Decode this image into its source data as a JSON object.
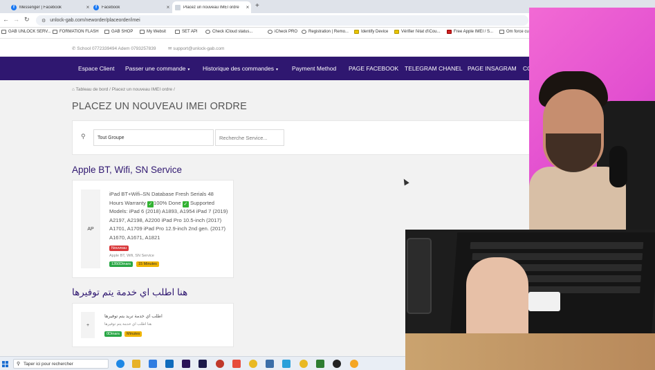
{
  "browser": {
    "tabs": [
      {
        "label": "Messenger | Facebook",
        "icon": "facebook-icon",
        "active": false
      },
      {
        "label": "Facebook",
        "icon": "facebook-icon",
        "active": false
      },
      {
        "label": "Placez un nouveau IMEI ordre",
        "icon": "page-icon",
        "active": true
      }
    ],
    "new_tab": "+",
    "url": "unlock-gab.com/neworder/placeorder/imei",
    "bookmarks": [
      "GAB UNLOCK SERV...",
      "FORMATION FLASH",
      "GAB SHOP",
      "My Websit",
      "SET API",
      "Check iCloud status...",
      "iCheck PRO",
      "Registration | Remo...",
      "Identify Device",
      "Vérifier l'état d'iCou...",
      "Free Apple IMEI / S...",
      "Om force cursu"
    ]
  },
  "site": {
    "phone": "School 0772339494 Adem 0793257839",
    "email": "support@unlock-gab.com",
    "nav": [
      {
        "label": "Espace Client",
        "has_caret": false
      },
      {
        "label": "Passer une commande",
        "has_caret": true
      },
      {
        "label": "Historique des commandes",
        "has_caret": true
      },
      {
        "label": "Payment Method",
        "has_caret": false
      },
      {
        "label": "PAGE FACEBOOK",
        "has_caret": false
      },
      {
        "label": "TELEGRAM CHANEL",
        "has_caret": false
      },
      {
        "label": "PAGE INSAGRAM",
        "has_caret": false
      },
      {
        "label": "CO",
        "has_caret": false
      }
    ],
    "breadcrumb": [
      "Tableau de bord",
      "Placez un nouveau IMEI ordre"
    ],
    "title": "PLACEZ UN NOUVEAU IMEI ORDRE",
    "filter": {
      "group_select": "Tout Groupe",
      "search_placeholder": "Recherche Service..."
    },
    "groups": [
      {
        "title": "Apple BT, Wifi, SN Service",
        "card": {
          "thumb": "AP",
          "desc_1": "iPad BT+Wifi–SN Database Fresh Serials 48 Hours Warranty",
          "desc_2": "100% Done",
          "desc_3": "Supported Models: iPad 6 (2018) A1893, A1954 iPad 7 (2019) A2197, A2198, A2200 iPad Pro 10.5-inch (2017) A1701, A1709 iPad Pro 12.9-inch 2nd gen. (2017) A1670, A1671, A1821",
          "tag": "Nouveau",
          "category": "Apple BT, Wifi, SN Service",
          "price": "1350Dinars",
          "time": "15 Minutes"
        }
      },
      {
        "title": "هنا اطلب اي خدمة يتم توفيرها",
        "card": {
          "thumb": "+",
          "desc_1": "اطلب اي خدمة تريد يتم توفيرها",
          "category": "هنا اطلب اي خدمة يتم توفيرها",
          "price": "0Dinars",
          "time": "Minutes"
        }
      }
    ]
  },
  "taskbar": {
    "search_placeholder": "Taper ici pour rechercher"
  },
  "colors": {
    "nav_bg": "#2f1770",
    "title_purple": "#2f1770",
    "badge_red": "#d9383a",
    "badge_green": "#28a745",
    "badge_yellow": "#f0b400",
    "webcam_bg": "#e24fd0"
  }
}
